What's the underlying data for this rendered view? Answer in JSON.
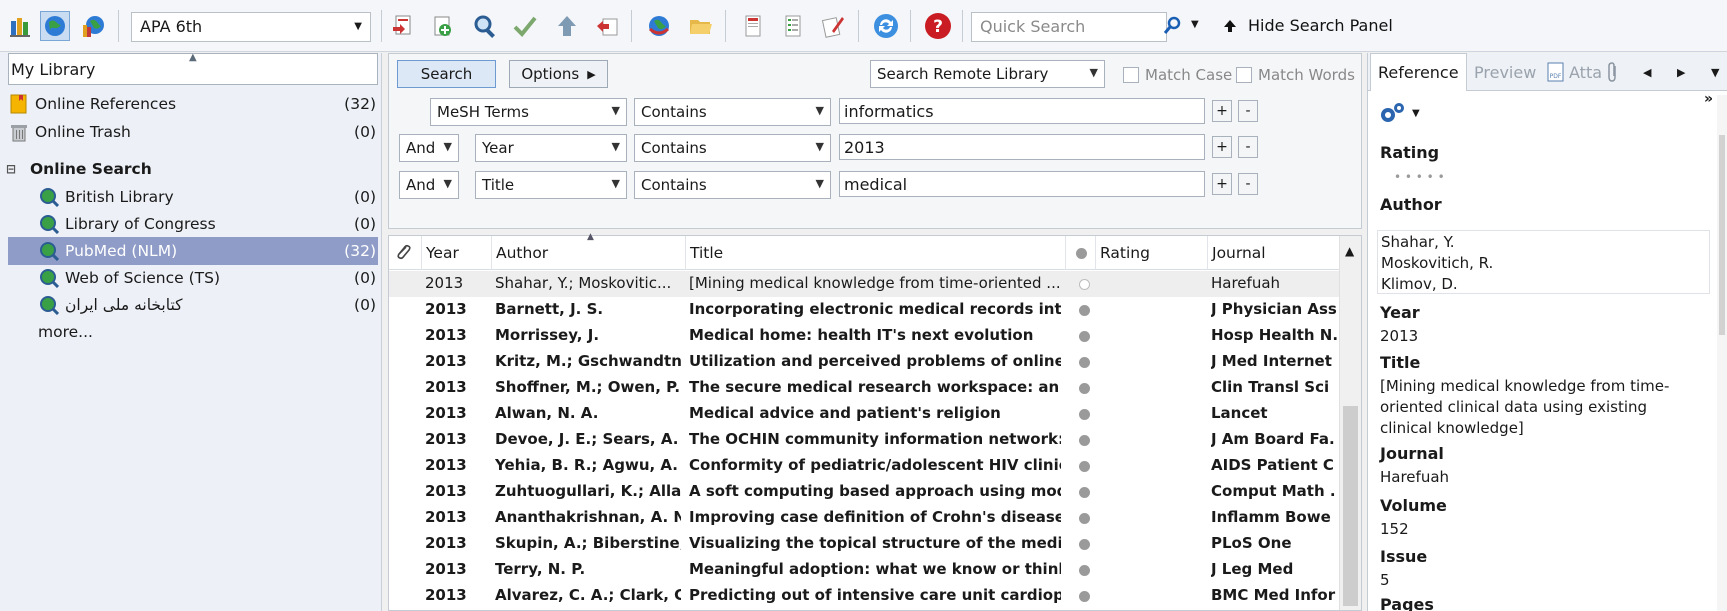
{
  "toolbar": {
    "style_select": "APA 6th",
    "quick_search_placeholder": "Quick Search",
    "hide_panel_label": "Hide Search Panel"
  },
  "left": {
    "header": "My Library",
    "items": [
      {
        "label": "Online References",
        "count": "(32)"
      },
      {
        "label": "Online Trash",
        "count": "(0)"
      },
      {
        "label": "Online Search",
        "count": ""
      },
      {
        "label": "British Library",
        "count": "(0)"
      },
      {
        "label": "Library of Congress",
        "count": "(0)"
      },
      {
        "label": "PubMed (NLM)",
        "count": "(32)"
      },
      {
        "label": "Web of Science (TS)",
        "count": "(0)"
      },
      {
        "label": "کتابخانه ملی ایران",
        "count": "(0)"
      },
      {
        "label": "more...",
        "count": ""
      }
    ]
  },
  "search": {
    "search_label": "Search",
    "options_label": "Options",
    "remote_library": "Search Remote Library",
    "match_case": "Match Case",
    "match_words": "Match Words",
    "rows": [
      {
        "bool": "",
        "field": "MeSH Terms",
        "op": "Contains",
        "value": "informatics"
      },
      {
        "bool": "And",
        "field": "Year",
        "op": "Contains",
        "value": "2013"
      },
      {
        "bool": "And",
        "field": "Title",
        "op": "Contains",
        "value": "medical"
      }
    ],
    "plus": "+",
    "minus": "-"
  },
  "table": {
    "headers": {
      "year": "Year",
      "author": "Author",
      "title": "Title",
      "rating": "Rating",
      "journal": "Journal"
    },
    "rows": [
      {
        "year": "2013",
        "author": "Shahar, Y.; Moskovitic...",
        "title": "[Mining medical knowledge from time-oriented ...",
        "journal": "Harefuah"
      },
      {
        "year": "2013",
        "author": "Barnett, J. S.",
        "title": "Incorporating electronic medical records into t...",
        "journal": "J Physician Assi"
      },
      {
        "year": "2013",
        "author": "Morrissey, J.",
        "title": "Medical home: health IT's next evolution",
        "journal": "Hosp Health N."
      },
      {
        "year": "2013",
        "author": "Kritz, M.; Gschwandtn...",
        "title": "Utilization and perceived problems of online ...",
        "journal": "J Med Internet"
      },
      {
        "year": "2013",
        "author": "Shoffner, M.; Owen, P....",
        "title": "The secure medical research workspace: an IT ...",
        "journal": "Clin Transl Sci"
      },
      {
        "year": "2013",
        "author": "Alwan, N. A.",
        "title": "Medical advice and patient's religion",
        "journal": "Lancet"
      },
      {
        "year": "2013",
        "author": "Devoe, J. E.; Sears, A.",
        "title": "The OCHIN community information network: ...",
        "journal": "J Am Board Fa."
      },
      {
        "year": "2013",
        "author": "Yehia, B. R.; Agwu, A. ...",
        "title": "Conformity of pediatric/adolescent HIV clinics ...",
        "journal": "AIDS Patient C"
      },
      {
        "year": "2013",
        "author": "Zuhtuogullari, K.; Alla...",
        "title": "A soft computing based approach using modifi...",
        "journal": "Comput Math ."
      },
      {
        "year": "2013",
        "author": "Ananthakrishnan, A. N...",
        "title": "Improving case definition of Crohn's disease an...",
        "journal": "Inflamm Bowe"
      },
      {
        "year": "2013",
        "author": "Skupin, A.; Biberstine,...",
        "title": "Visualizing the topical structure of the medical...",
        "journal": "PLoS One"
      },
      {
        "year": "2013",
        "author": "Terry, N. P.",
        "title": "Meaningful adoption: what we know or think ...",
        "journal": "J Leg Med"
      },
      {
        "year": "2013",
        "author": "Alvarez, C. A.; Clark, C....",
        "title": "Predicting out of intensive care unit cardiopul...",
        "journal": "BMC Med Infor"
      }
    ]
  },
  "right": {
    "tabs": {
      "reference": "Reference",
      "preview": "Preview",
      "attach": "Atta"
    },
    "fields": {
      "rating_label": "Rating",
      "rating_dots": "•   •   •   •   •",
      "author_label": "Author",
      "authors": [
        "Shahar, Y.",
        "Moskovitich, R.",
        "Klimov, D."
      ],
      "year_label": "Year",
      "year": "2013",
      "title_label": "Title",
      "title": "[Mining medical knowledge from time-oriented clinical data using existing clinical knowledge]",
      "journal_label": "Journal",
      "journal": "Harefuah",
      "volume_label": "Volume",
      "volume": "152",
      "issue_label": "Issue",
      "issue": "5",
      "pages_label": "Pages"
    }
  },
  "colors": {
    "selected_row": "#8f9cc7",
    "accent": "#1a5fb4",
    "help_red": "#c91d23"
  }
}
